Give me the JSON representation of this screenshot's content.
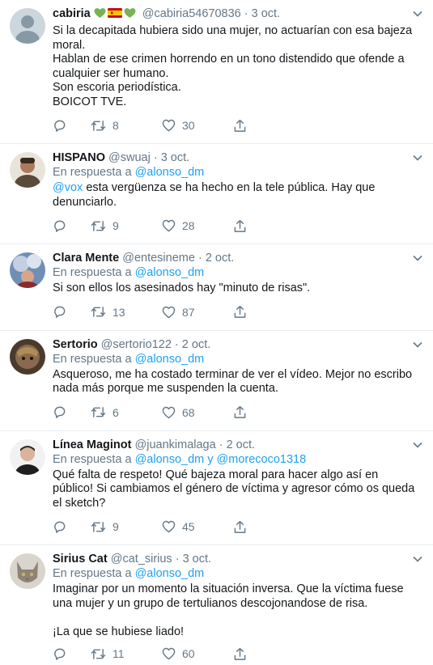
{
  "tweets": [
    {
      "name": "cabiria",
      "handle": "@cabiria54670836",
      "date": "3 oct.",
      "reply_prefix": "",
      "reply_to": "",
      "body": [
        "Si la decapitada hubiera sido una mujer, no actuarían con esa bajeza moral.",
        "Hablan de ese crimen horrendo en un tono distendido que ofende a cualquier ser humano.",
        "Son escoria periodística.",
        "BOICOT TVE."
      ],
      "retweets": "8",
      "likes": "30"
    },
    {
      "name": "HISPANO",
      "handle": "@swuaj",
      "date": "3 oct.",
      "reply_prefix": "En respuesta a",
      "reply_to": "@alonso_dm",
      "mention": "@vox",
      "body_rest": " esta vergüenza se ha hecho en la tele pública. Hay que denunciarlo.",
      "retweets": "9",
      "likes": "28"
    },
    {
      "name": "Clara Mente",
      "handle": "@entesineme",
      "date": "2 oct.",
      "reply_prefix": "En respuesta a",
      "reply_to": "@alonso_dm",
      "body": [
        "Si son ellos los asesinados hay \"minuto de risas\"."
      ],
      "retweets": "13",
      "likes": "87"
    },
    {
      "name": "Sertorio",
      "handle": "@sertorio122",
      "date": "2 oct.",
      "reply_prefix": "En respuesta a",
      "reply_to": "@alonso_dm",
      "body": [
        "Asqueroso, me ha costado terminar de ver el vídeo. Mejor no escribo nada más porque me suspenden la cuenta."
      ],
      "retweets": "6",
      "likes": "68"
    },
    {
      "name": "Línea Maginot",
      "handle": "@juankimalaga",
      "date": "2 oct.",
      "reply_prefix": "En respuesta a",
      "reply_to": "@alonso_dm y @morecoco1318",
      "body": [
        "Qué falta de respeto! Qué bajeza moral para hacer algo así en público! Si cambiamos el género de víctima y agresor cómo os queda el sketch?"
      ],
      "retweets": "9",
      "likes": "45"
    },
    {
      "name": "Sirius Cat",
      "handle": "@cat_sirius",
      "date": "3 oct.",
      "reply_prefix": "En respuesta a",
      "reply_to": "@alonso_dm",
      "body": [
        "Imaginar por un momento la situación inversa. Que la víctima fuese una mujer y un grupo de tertulianos descojonandose de risa.",
        "¡La que se hubiese liado!"
      ],
      "retweets": "11",
      "likes": "60"
    }
  ],
  "colors": {
    "text": "#14171a",
    "muted": "#657786",
    "link": "#1da1f2",
    "divider": "#e6ecf0"
  },
  "icons": [
    "chevron-down-icon",
    "reply-icon",
    "retweet-icon",
    "like-icon",
    "share-icon"
  ]
}
